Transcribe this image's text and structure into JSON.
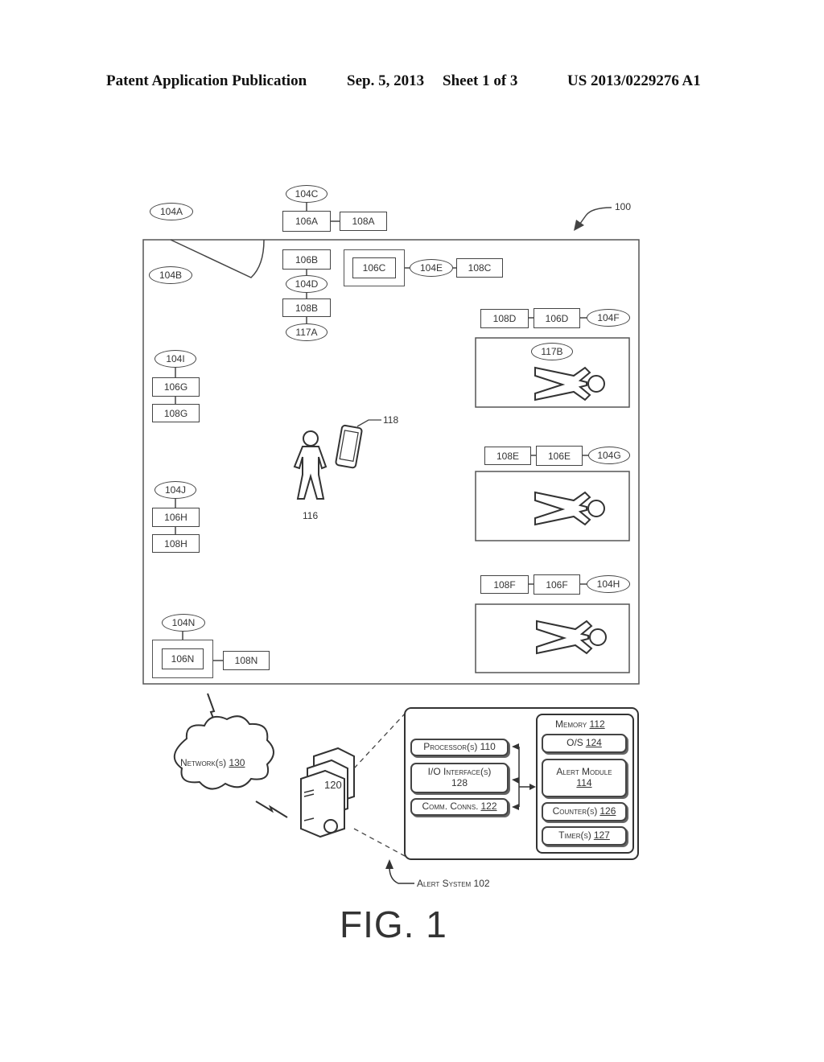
{
  "header": {
    "left": "Patent Application Publication",
    "date": "Sep. 5, 2013",
    "sheet": "Sheet 1 of 3",
    "pub_number": "US 2013/0229276 A1"
  },
  "ref_labels": {
    "environment": "100",
    "person": "116",
    "device": "118",
    "server": "120",
    "alert_system": "Alert System 102"
  },
  "nodes": {
    "n104A": "104A",
    "n104B": "104B",
    "n104C": "104C",
    "n104D": "104D",
    "n104E": "104E",
    "n104F": "104F",
    "n104G": "104G",
    "n104H": "104H",
    "n104I": "104I",
    "n104J": "104J",
    "n104N": "104N",
    "n106A": "106A",
    "n106B": "106B",
    "n106C": "106C",
    "n106D": "106D",
    "n106E": "106E",
    "n106F": "106F",
    "n106G": "106G",
    "n106H": "106H",
    "n106N": "106N",
    "n108A": "108A",
    "n108B": "108B",
    "n108C": "108C",
    "n108D": "108D",
    "n108E": "108E",
    "n108F": "108F",
    "n108G": "108G",
    "n108H": "108H",
    "n108N": "108N",
    "n117A": "117A",
    "n117B": "117B"
  },
  "network": {
    "label": "Network(s)",
    "ref": "130"
  },
  "system_block": {
    "left": [
      {
        "label": "Processor(s) 110",
        "ref": ""
      },
      {
        "label": "I/O Interface(s)",
        "ref": "128"
      },
      {
        "label": "Comm. Conns.",
        "ref": "122"
      }
    ],
    "memory": {
      "label": "Memory",
      "ref": "112"
    },
    "memory_items": [
      {
        "label": "O/S",
        "ref": "124"
      },
      {
        "label": "Alert Module",
        "ref": "114"
      },
      {
        "label": "Counter(s)",
        "ref": "126"
      },
      {
        "label": "Timer(s)",
        "ref": "127"
      }
    ]
  },
  "figure_label": "FIG. 1"
}
